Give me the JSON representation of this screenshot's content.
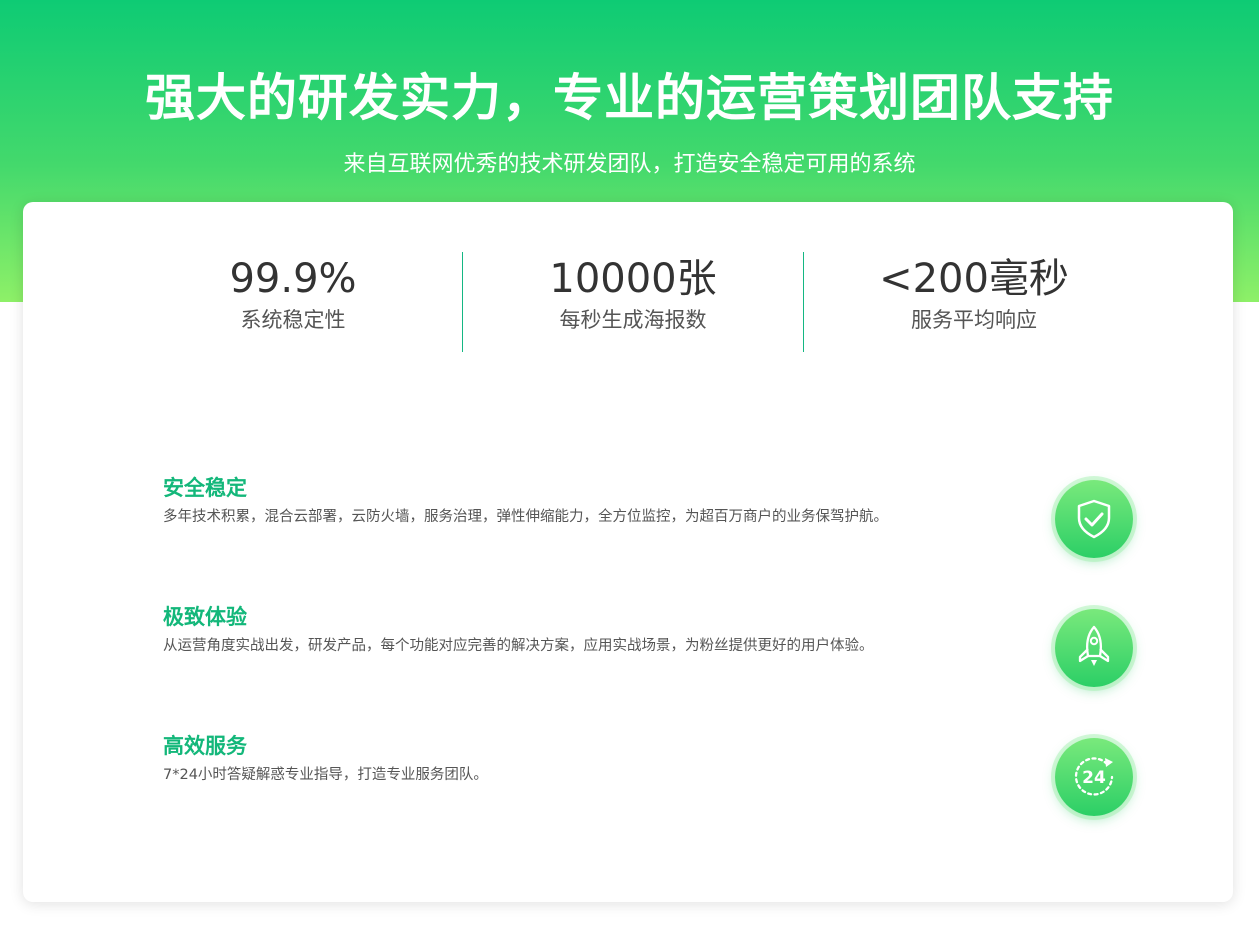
{
  "hero": {
    "title": "强大的研发实力，专业的运营策划团队支持",
    "subtitle": "来自互联网优秀的技术研发团队，打造安全稳定可用的系统"
  },
  "stats": [
    {
      "value": "99.9%",
      "label": "系统稳定性"
    },
    {
      "value": "10000张",
      "label": "每秒生成海报数"
    },
    {
      "value": "<200毫秒",
      "label": "服务平均响应"
    }
  ],
  "features": [
    {
      "title": "安全稳定",
      "desc": "多年技术积累，混合云部署，云防火墙，服务治理，弹性伸缩能力，全方位监控，为超百万商户的业务保驾护航。",
      "icon": "shield-check-icon"
    },
    {
      "title": "极致体验",
      "desc": "从运营角度实战出发，研发产品，每个功能对应完善的解决方案，应用实战场景，为粉丝提供更好的用户体验。",
      "icon": "rocket-icon"
    },
    {
      "title": "高效服务",
      "desc": "7*24小时答疑解惑专业指导，打造专业服务团队。",
      "icon": "clock-24-icon",
      "icon_text": "24"
    }
  ],
  "colors": {
    "accent": "#13b77a",
    "hero_top": "#0ecb74",
    "hero_bottom": "#8ef068",
    "divider": "#14b783"
  }
}
